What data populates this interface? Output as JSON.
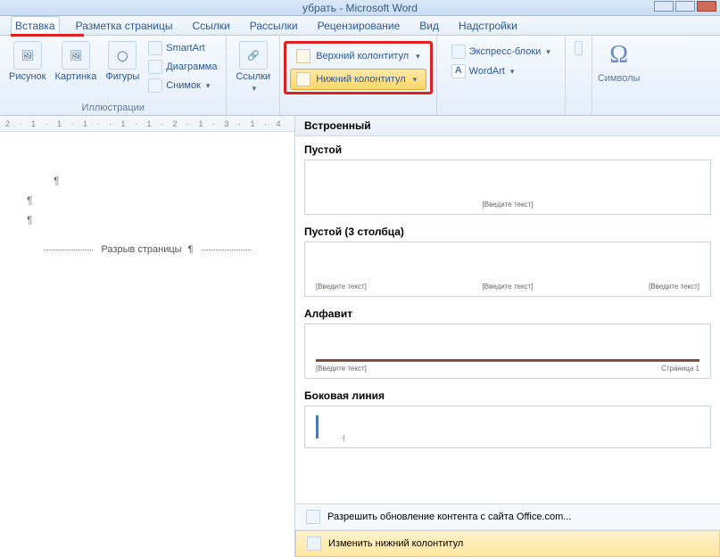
{
  "title": "убрать - Microsoft Word",
  "tabs": {
    "insert": "Вставка",
    "layout": "Разметка страницы",
    "refs": "Ссылки",
    "mail": "Рассылки",
    "review": "Рецензирование",
    "view": "Вид",
    "addins": "Надстройки"
  },
  "illustrations": {
    "picture": "Рисунок",
    "clipart": "Картинка",
    "shapes": "Фигуры",
    "smartart": "SmartArt",
    "chart": "Диаграмма",
    "screenshot": "Снимок",
    "group_label": "Иллюстрации"
  },
  "links": {
    "links_btn": "Ссылки"
  },
  "hf": {
    "header": "Верхний колонтитул",
    "footer": "Нижний колонтитул"
  },
  "text_group": {
    "quickparts": "Экспресс-блоки",
    "wordart": "WordArt"
  },
  "symbols": {
    "label": "Символы"
  },
  "ruler_text": "2 · 1 · 1 · 1 ·  · 1 · 1 · 2 · 1 · 3 · 1 · 4",
  "document": {
    "pilcrow": "¶",
    "page_break": "Разрыв страницы"
  },
  "gallery": {
    "header": "Встроенный",
    "items": {
      "blank": "Пустой",
      "blank3": "Пустой (3 столбца)",
      "alphabet": "Алфавит",
      "sideline": "Боковая линия"
    },
    "placeholder": "[Введите текст]",
    "page_n": "Страница 1",
    "footer": {
      "allow_update": "Разрешить обновление контента с сайта Office.com...",
      "edit_footer": "Изменить нижний колонтитул"
    }
  }
}
